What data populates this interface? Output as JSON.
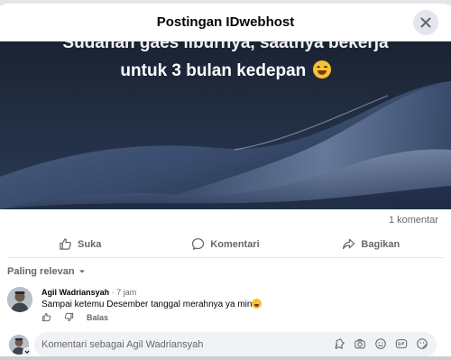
{
  "dialog": {
    "title": "Postingan IDwebhost"
  },
  "post": {
    "text_line_1": "Sudahan gaes liburnya, saatnya bekerja",
    "text_line_2": "untuk 3 bulan kedepan",
    "emoji_icon": "grinning-squinting-face-icon"
  },
  "stats": {
    "comment_count": "1 komentar"
  },
  "actions": {
    "like_label": "Suka",
    "comment_label": "Komentari",
    "share_label": "Bagikan"
  },
  "comments_sort": {
    "label": "Paling relevan"
  },
  "comments": [
    {
      "author": "Agil Wadriansyah",
      "separator": "·",
      "time": "7 jam",
      "text": "Sampai ketemu Desember tanggal merahnya ya min",
      "reply_label": "Balas"
    }
  ],
  "composer": {
    "placeholder": "Komentari sebagai Agil Wadriansyah",
    "value": ""
  },
  "colors": {
    "text_primary": "#050505",
    "text_secondary": "#65676b",
    "divider": "#e4e6eb",
    "input_bg": "#f0f2f5"
  }
}
